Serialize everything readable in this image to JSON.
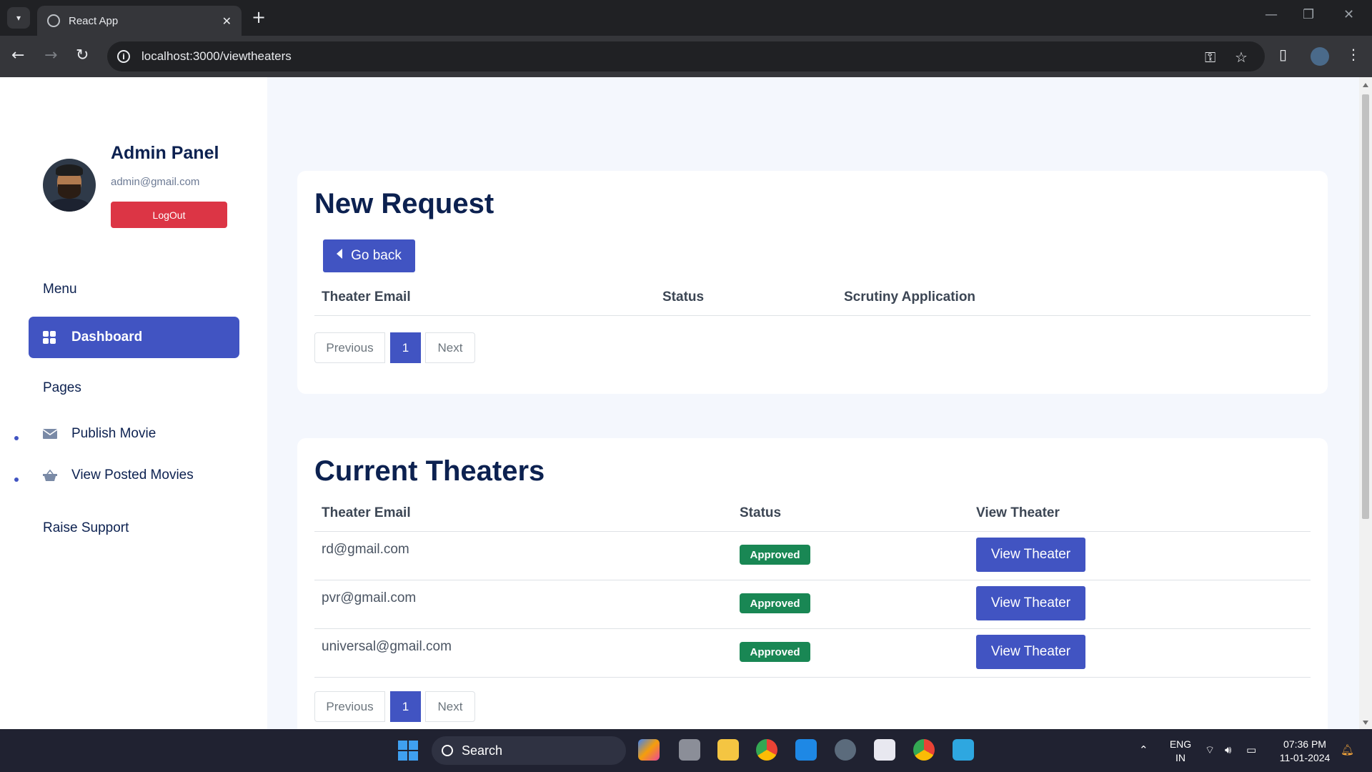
{
  "browser": {
    "tab_title": "React App",
    "url": "localhost:3000/viewtheaters",
    "new_tab_symbol": "+",
    "close_symbol": "✕"
  },
  "sidebar": {
    "title": "Admin Panel",
    "email": "admin@gmail.com",
    "logout_label": "LogOut",
    "menu_label": "Menu",
    "dashboard_label": "Dashboard",
    "pages_label": "Pages",
    "items": [
      {
        "label": "Publish Movie",
        "icon": "envelope-icon"
      },
      {
        "label": "View Posted Movies",
        "icon": "basket-icon"
      }
    ],
    "support_label": "Raise Support"
  },
  "new_request": {
    "title": "New Request",
    "go_back_label": "Go back",
    "columns": [
      "Theater Email",
      "Status",
      "Scrutiny Application"
    ],
    "rows": [],
    "pagination": {
      "prev": "Previous",
      "current": "1",
      "next": "Next"
    }
  },
  "current_theaters": {
    "title": "Current Theaters",
    "columns": [
      "Theater Email",
      "Status",
      "View Theater"
    ],
    "rows": [
      {
        "email": "rd@gmail.com",
        "status": "Approved",
        "action": "View Theater"
      },
      {
        "email": "pvr@gmail.com",
        "status": "Approved",
        "action": "View Theater"
      },
      {
        "email": "universal@gmail.com",
        "status": "Approved",
        "action": "View Theater"
      }
    ],
    "pagination": {
      "prev": "Previous",
      "current": "1",
      "next": "Next"
    }
  },
  "taskbar": {
    "search_label": "Search",
    "lang_line1": "ENG",
    "lang_line2": "IN",
    "time": "07:36 PM",
    "date": "11-01-2024"
  },
  "colors": {
    "primary": "#4154c2",
    "danger": "#dc3545",
    "success": "#198754",
    "heading": "#0c2150",
    "page_bg": "#f4f7fd"
  }
}
